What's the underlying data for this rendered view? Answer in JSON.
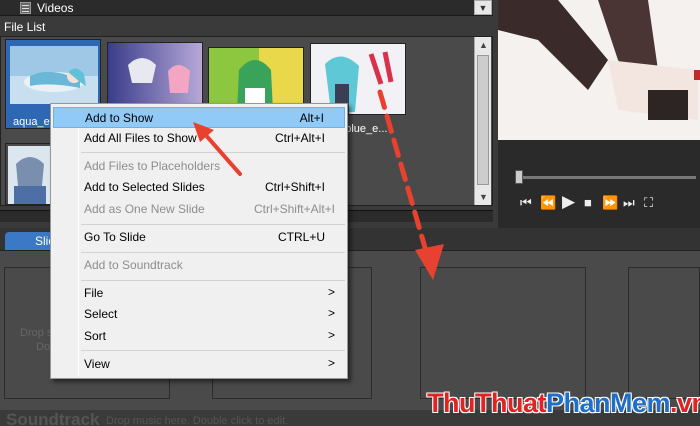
{
  "folder": {
    "label": "Videos",
    "dropdown": "▼"
  },
  "file_list": {
    "label": "File List",
    "thumbnails": [
      {
        "label": "aqua_ey",
        "selected": true
      },
      {
        "label": ""
      },
      {
        "label": ""
      },
      {
        "label": "d_blue_e..."
      },
      {
        "label": ""
      }
    ]
  },
  "slides": {
    "tab_label": "Slid",
    "drop_text_1": "Drop s",
    "drop_text_2": "Do"
  },
  "soundtrack": {
    "label": "Soundtrack",
    "hint": "Drop music here.  Double click to edit."
  },
  "context_menu": {
    "items": [
      {
        "label": "Add to Show",
        "shortcut": "Alt+I",
        "state": "hover"
      },
      {
        "label": "Add All Files to Show",
        "shortcut": "Ctrl+Alt+I"
      },
      {
        "label": "Add Files to Placeholders",
        "shortcut": "",
        "state": "disabled"
      },
      {
        "label": "Add to Selected Slides",
        "shortcut": "Ctrl+Shift+I"
      },
      {
        "label": "Add as One New Slide",
        "shortcut": "Ctrl+Shift+Alt+I",
        "state": "disabled"
      },
      {
        "label": "Go To Slide",
        "shortcut": "CTRL+U"
      },
      {
        "label": "Add to Soundtrack",
        "shortcut": "",
        "state": "disabled"
      },
      {
        "label": "File",
        "submenu": true
      },
      {
        "label": "Select",
        "submenu": true
      },
      {
        "label": "Sort",
        "submenu": true
      },
      {
        "label": "View",
        "submenu": true
      }
    ],
    "submenu_arrow": ">"
  },
  "player_controls": [
    "⏮",
    "⏪",
    "▶",
    "■",
    "⏩",
    "⏭",
    "⛶"
  ],
  "watermark": {
    "part1": "Thu",
    "part2": "Thuat",
    "part3": "PhanMem",
    "part4": ".vn"
  },
  "colors": {
    "accent": "#3b78c6",
    "menu_hover": "#91c9f7",
    "annotation_red": "#e8412f",
    "watermark_blue": "#1f6fc9"
  }
}
